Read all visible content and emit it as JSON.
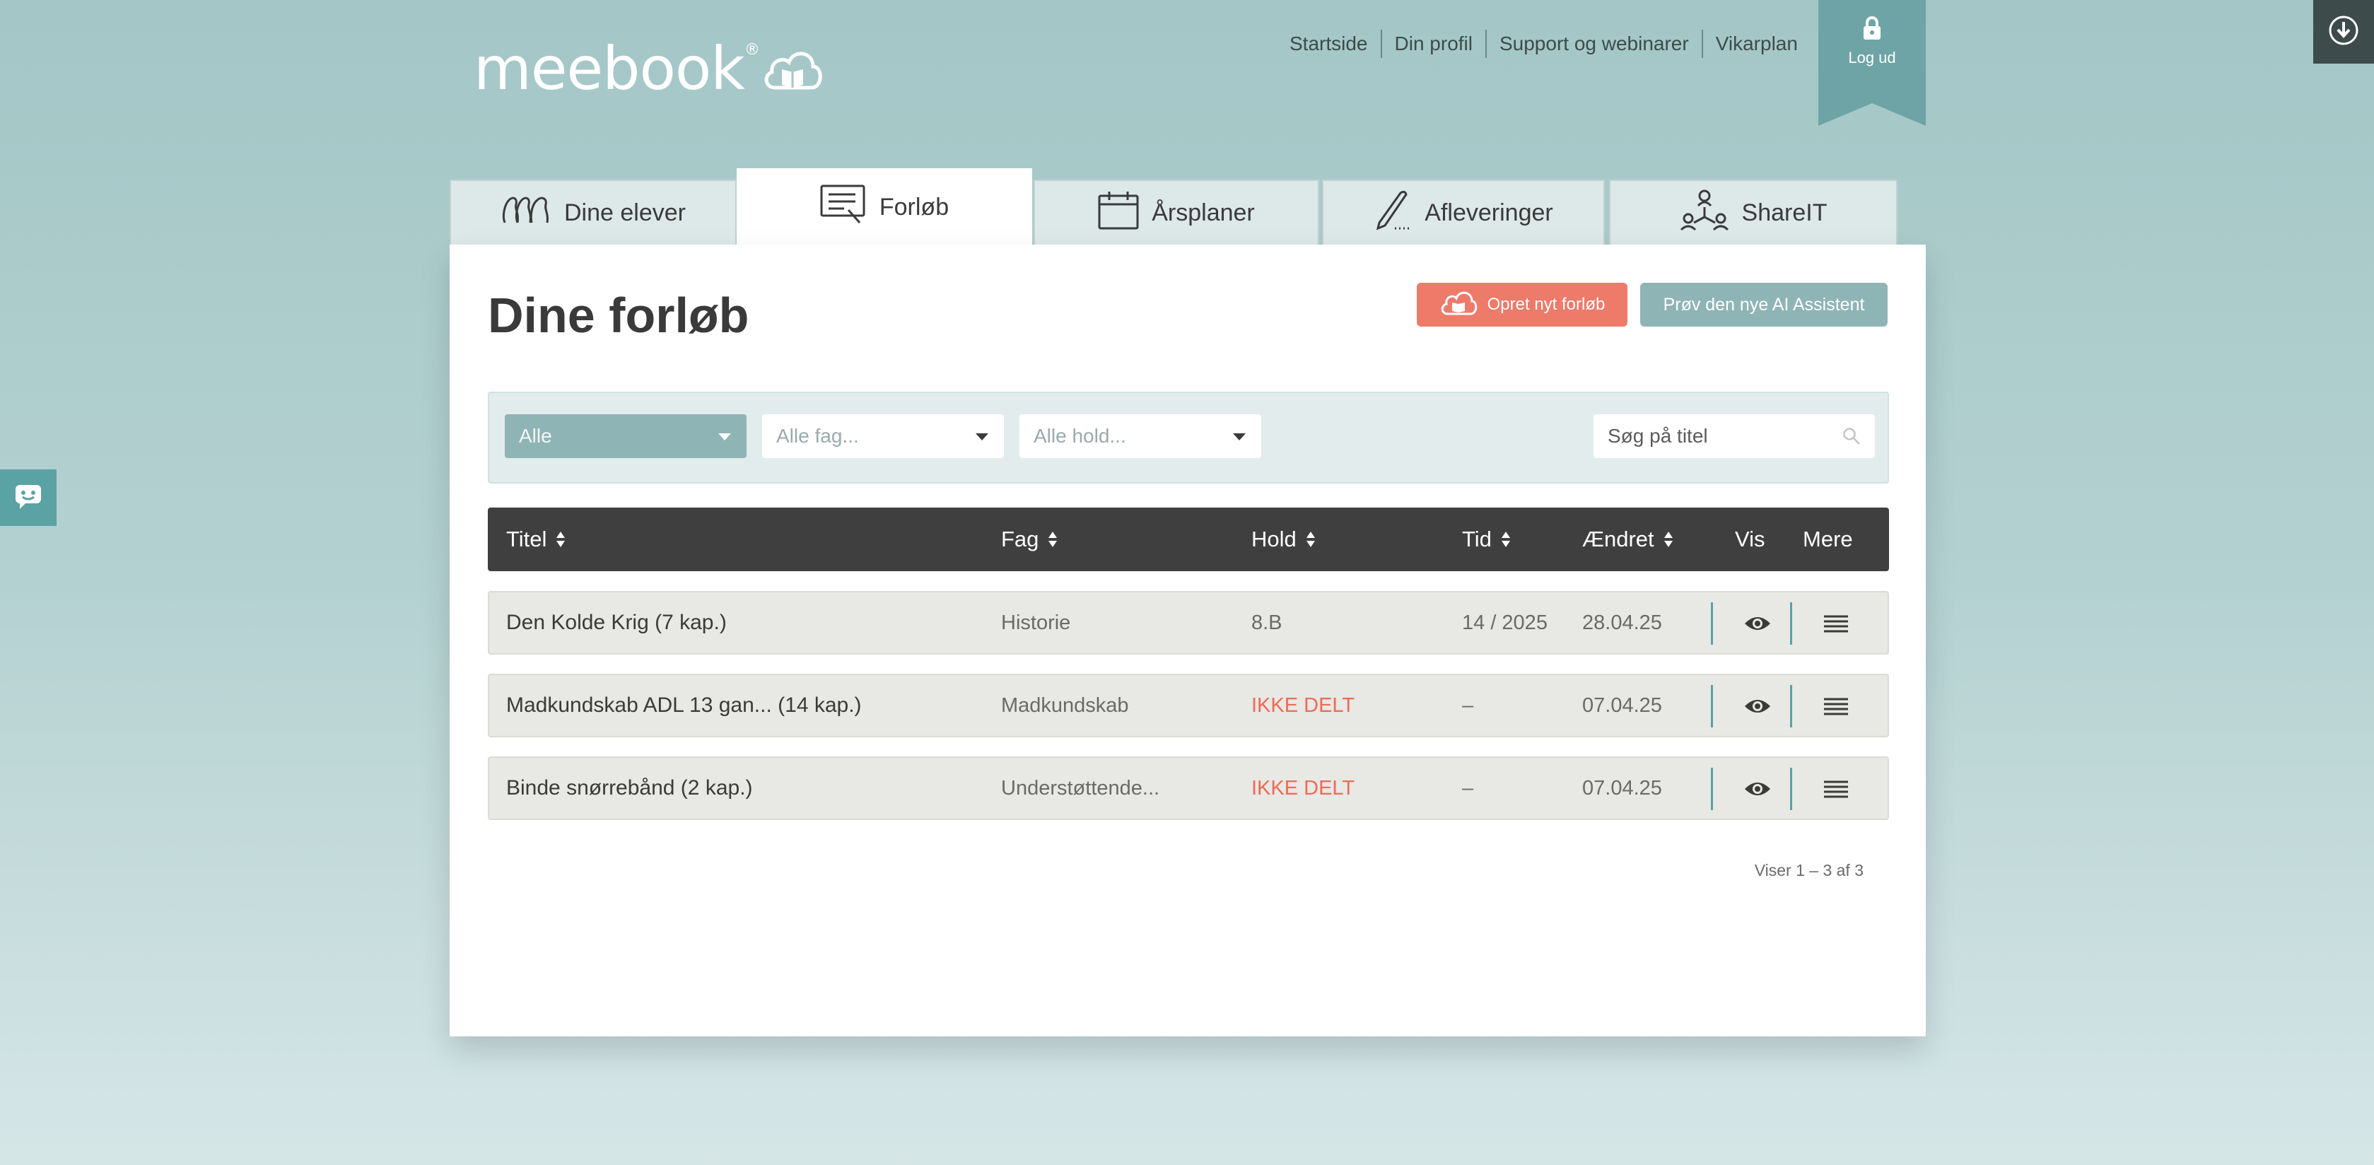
{
  "logo": {
    "text": "meebook",
    "reg": "®"
  },
  "topnav": {
    "items": [
      "Startside",
      "Din profil",
      "Support og webinarer",
      "Vikarplan"
    ],
    "logout": "Log ud"
  },
  "tabs": [
    {
      "label": "Dine elever",
      "icon": "students-icon"
    },
    {
      "label": "Forløb",
      "icon": "course-icon",
      "active": true
    },
    {
      "label": "Årsplaner",
      "icon": "calendar-icon"
    },
    {
      "label": "Afleveringer",
      "icon": "pen-icon"
    },
    {
      "label": "ShareIT",
      "icon": "share-network-icon"
    }
  ],
  "page": {
    "title": "Dine forløb",
    "new_button": "Opret nyt forløb",
    "ai_button": "Prøv den nye AI Assistent"
  },
  "filters": {
    "type": "Alle",
    "subject": "Alle fag...",
    "class": "Alle hold...",
    "search_placeholder": "Søg på titel"
  },
  "table": {
    "headers": {
      "title": "Titel",
      "subject": "Fag",
      "class": "Hold",
      "time": "Tid",
      "changed": "Ændret",
      "view": "Vis",
      "more": "Mere"
    },
    "rows": [
      {
        "title": "Den Kolde Krig (7 kap.)",
        "subject": "Historie",
        "class": "8.B",
        "time": "14 / 2025",
        "changed": "28.04.25",
        "class_shared": true
      },
      {
        "title": "Madkundskab ADL 13 gan... (14 kap.)",
        "subject": "Madkundskab",
        "class": "IKKE DELT",
        "time": "–",
        "changed": "07.04.25",
        "class_shared": false
      },
      {
        "title": "Binde snørrebånd (2 kap.)",
        "subject": "Understøttende...",
        "class": "IKKE DELT",
        "time": "–",
        "changed": "07.04.25",
        "class_shared": false
      }
    ]
  },
  "pager": "Viser 1 – 3 af 3",
  "colors": {
    "accent": "#5aa2a4",
    "danger": "#ee7a6a",
    "header": "#3f3f3f"
  }
}
